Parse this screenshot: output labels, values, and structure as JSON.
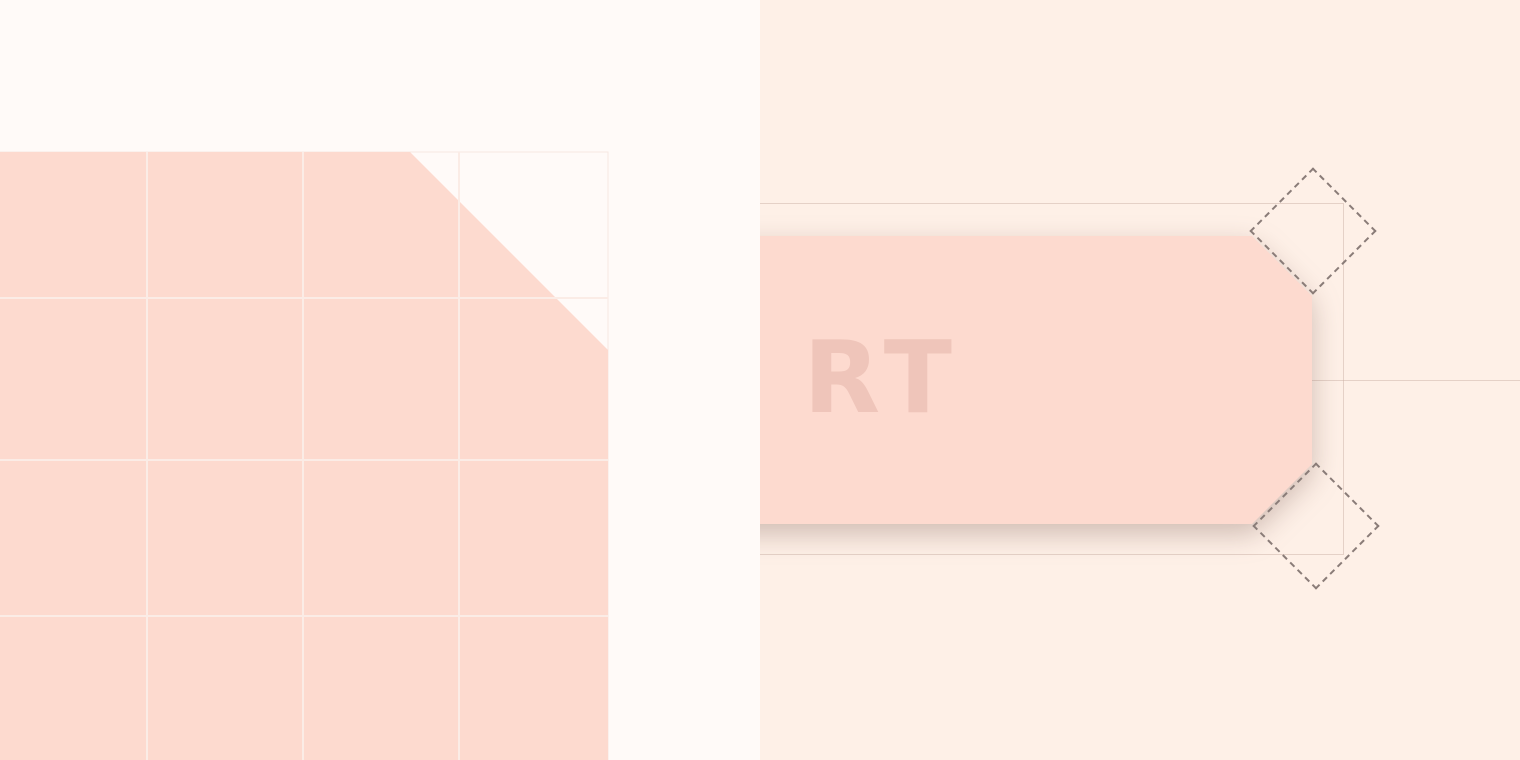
{
  "canvas": {
    "left_panel": {
      "grid": {
        "rows": 4,
        "columns": 4,
        "fill_color": "#fddacf",
        "line_color": "#fbe9e2"
      }
    },
    "right_panel": {
      "slab": {
        "label": "RT",
        "fill_color": "#fddacf",
        "text_color": "#efc5ba"
      },
      "corner_handles": [
        "top-right-handle",
        "bottom-right-handle"
      ]
    }
  }
}
